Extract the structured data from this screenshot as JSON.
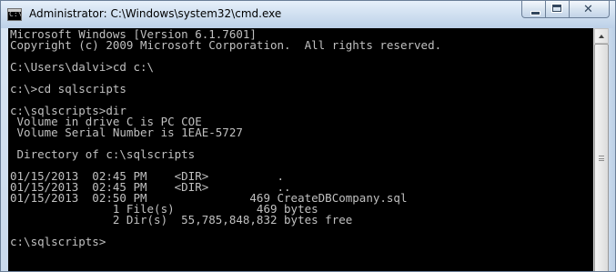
{
  "window": {
    "title": "Administrator: C:\\Windows\\system32\\cmd.exe",
    "icon": "cmd-icon",
    "icon_glyph": "C:\\_"
  },
  "caption_buttons": {
    "minimize": "minimize-icon",
    "maximize": "maximize-icon",
    "close": "close-icon",
    "close_glyph": "✕"
  },
  "console": {
    "background": "#000000",
    "foreground": "#c0c0c0",
    "lines": [
      "Microsoft Windows [Version 6.1.7601]",
      "Copyright (c) 2009 Microsoft Corporation.  All rights reserved.",
      "",
      "C:\\Users\\dalvi>cd c:\\",
      "",
      "c:\\>cd sqlscripts",
      "",
      "c:\\sqlscripts>dir",
      " Volume in drive C is PC COE",
      " Volume Serial Number is 1EAE-5727",
      "",
      " Directory of c:\\sqlscripts",
      "",
      "01/15/2013  02:45 PM    <DIR>          .",
      "01/15/2013  02:45 PM    <DIR>          ..",
      "01/15/2013  02:50 PM               469 CreateDBCompany.sql",
      "               1 File(s)            469 bytes",
      "               2 Dir(s)  55,785,848,832 bytes free",
      "",
      "c:\\sqlscripts>"
    ]
  },
  "scrollbar": {
    "up_arrow": "up-arrow-icon",
    "thumb_fraction": 1.0
  }
}
